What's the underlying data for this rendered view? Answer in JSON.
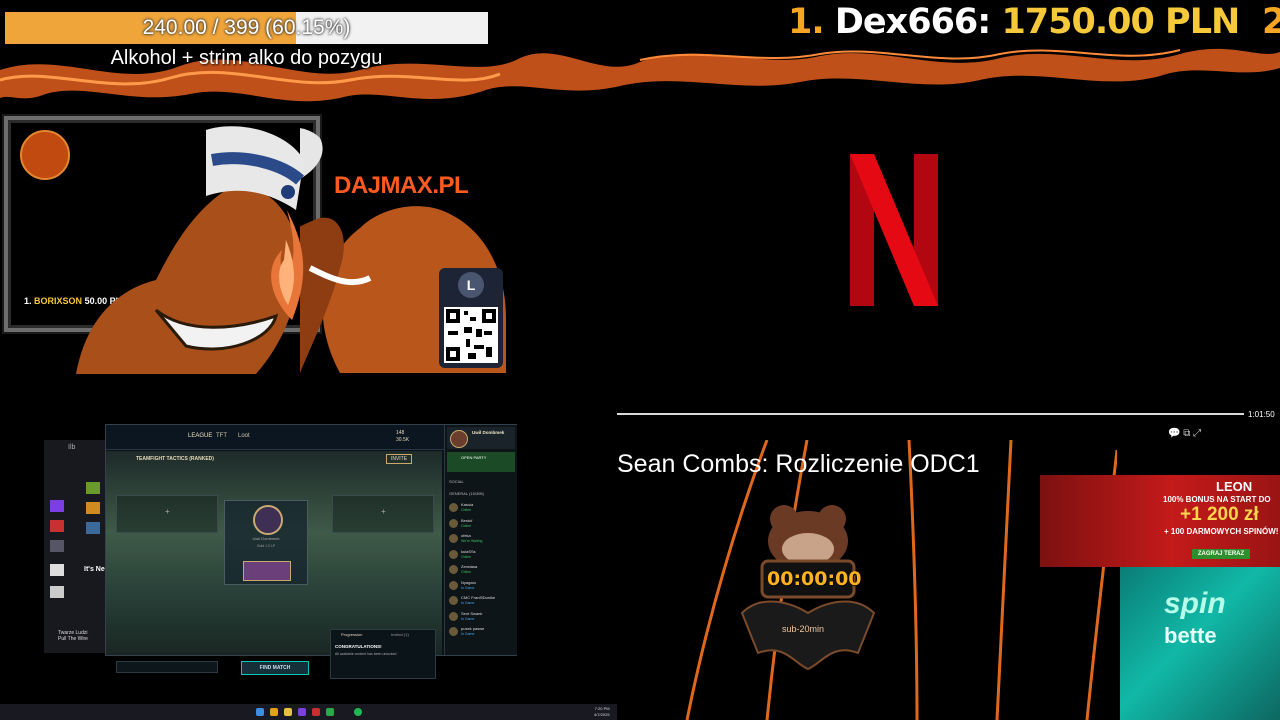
{
  "goal": {
    "progress_text": "240.00 / 399 (60.15%)",
    "progress_fraction": 0.6015,
    "label": "Alkohol + strim alko do pozygu"
  },
  "top_donor": {
    "rank": "1.",
    "name": "Dex666:",
    "amount": "1750.00 PLN",
    "next_rank": "2"
  },
  "webcam": {
    "donor_rank": "1.",
    "donor_name": "BORIXSON",
    "donor_amount": "50.00 PLN"
  },
  "promo": {
    "brand": "DAJMAX.PL",
    "coin_letter": "L"
  },
  "player": {
    "time": "1:01:50",
    "title": "Sean Combs: Rozliczenie ODC1",
    "progress_fraction": 0.99
  },
  "timer": {
    "value": "00:00:00",
    "subtitle": "sub-20min"
  },
  "ads": {
    "leon_brand": "LEON",
    "leon_line1": "100% BONUS NA START DO",
    "leon_line2": "+1 200 zł",
    "leon_line3": "+ 100 DARMOWYCH SPINÓW!",
    "leon_button": "ZAGRAJ TERAZ",
    "spin_line1": "spin",
    "spin_line2": "bette"
  },
  "store": {
    "header": "Ilb",
    "headline": "It's Ne",
    "bottom_title": "Twarze Ludzi",
    "bottom_sub": "Pull The Wire"
  },
  "lol": {
    "nav": [
      "LEAGUE",
      "TFT"
    ],
    "nav_badge": "Loot",
    "mode": "TEAMFIGHT TACTICS (RANKED)",
    "invite": "INVITE",
    "stats": [
      "148",
      "30.5K"
    ],
    "player_name": "Uwil Dombmek",
    "open_party": "OPEN PARTY",
    "social": "SOCIAL",
    "group": "GENERAL (15/395)",
    "center_name": "Uwil Dombmek",
    "center_rank": "Gold 1 0 LP",
    "find_match": "FIND MATCH",
    "progression_tab": "Progression",
    "second_tab": "Invited (1)",
    "congrats": "CONGRATULATIONS!",
    "congrats_sub": "All available content has been unlocked",
    "friends": [
      {
        "name": "Kasuia",
        "status": "Online",
        "game": false
      },
      {
        "name": "Bestuf",
        "status": "Online",
        "game": false
      },
      {
        "name": "ofeka",
        "status": "We're Waiting",
        "game": false
      },
      {
        "name": "kulaSSs",
        "status": "Online",
        "game": false
      },
      {
        "name": "Zerwiasa",
        "status": "Online",
        "game": false
      },
      {
        "name": "Nyagaro",
        "status": "In Game",
        "game": true
      },
      {
        "name": "CMC Franf3Dunike",
        "status": "In Game",
        "game": true
      },
      {
        "name": "Sent Swank",
        "status": "In Game",
        "game": true
      },
      {
        "name": "pusek paswe",
        "status": "In Game",
        "game": true
      }
    ]
  },
  "taskbar": {
    "time": "7:20 PM",
    "date": "4/7/2025"
  },
  "colors": {
    "progress_fill": "#f0a53a",
    "rank_number": "#f6a623",
    "rank_amount": "#f6c93a",
    "netflix_red": "#e50914",
    "timer": "#ffb21f"
  }
}
